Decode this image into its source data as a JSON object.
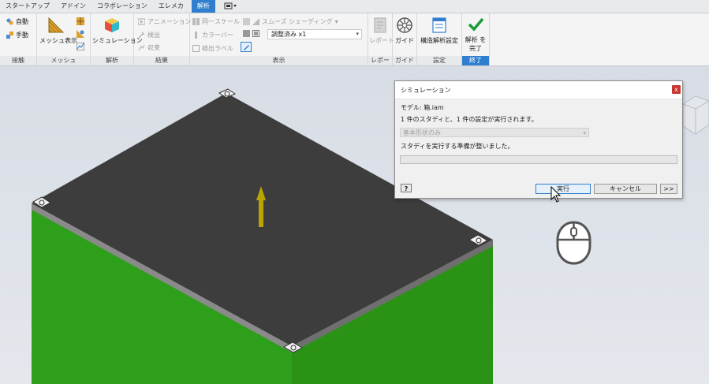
{
  "tabs": [
    "スタートアップ",
    "アドイン",
    "コラボレーション",
    "エレメカ",
    "解析"
  ],
  "active_tab": "解析",
  "ribbon": {
    "contact": {
      "auto": "自動",
      "manual": "手動",
      "title": "接触"
    },
    "mesh": {
      "show": "メッシュ表示",
      "title": "メッシュ"
    },
    "analysis": {
      "simulation": "シミュレーション",
      "title": "解析"
    },
    "results": {
      "animation": "アニメーション",
      "probe": "検出",
      "converge": "収束",
      "title": "結果"
    },
    "display": {
      "same_scale": "同一スケール",
      "smooth_shading": "スムーズ シェーディング",
      "color_bar": "カラーバー",
      "adjust_value": "調整済み x1",
      "probe_label": "検出ラベル",
      "title": "表示"
    },
    "report": {
      "report": "レポート",
      "title": "レポート"
    },
    "guide": {
      "guide": "ガイド",
      "title": "ガイド"
    },
    "settings": {
      "structural": "構造解析設定",
      "title": "設定"
    },
    "finish": {
      "finish_line1": "解析 を",
      "finish_line2": "完了",
      "title": "終了"
    }
  },
  "dialog": {
    "title": "シミュレーション",
    "close": "x",
    "model": "モデル: 箱.iam",
    "summary": "1 件のスタディと、1 件の設定が実行されます。",
    "study_select": "基本形状のみ",
    "status": "スタディを実行する準備が整いました。",
    "progress": 0,
    "help": "?",
    "run": "実行",
    "cancel": "キャンセル",
    "expand": ">>"
  },
  "colors": {
    "accent": "#2f7fce",
    "box_top": "#3d3d3d",
    "box_side": "#2e9f1a",
    "load_arrow": "#b8a600"
  }
}
